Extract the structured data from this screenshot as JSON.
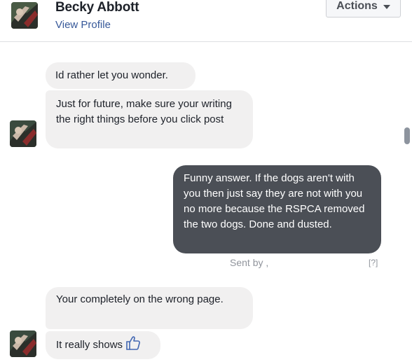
{
  "header": {
    "contact_name": "Becky Abbott",
    "view_profile": "View Profile",
    "actions_label": "Actions"
  },
  "messages": [
    {
      "direction": "received",
      "text": "Id rather let you wonder."
    },
    {
      "direction": "received",
      "text": "Just for future, make sure your writing the right things before you click post"
    },
    {
      "direction": "sent",
      "text": "Funny answer. If the dogs aren't with you then just say they are not with you no more because the RSPCA removed the two dogs. Done and dusted."
    },
    {
      "direction": "received",
      "text": "Your completely on the wrong page."
    },
    {
      "direction": "received",
      "text": "It really shows",
      "icon": "thumbs-up-icon"
    }
  ],
  "status": {
    "sent_by": "Sent by ,",
    "help": "[?]"
  },
  "colors": {
    "sent_bubble": "#4b4f56",
    "received_bubble": "#f1f0f0",
    "link": "#365899",
    "like": "#4267b2"
  }
}
